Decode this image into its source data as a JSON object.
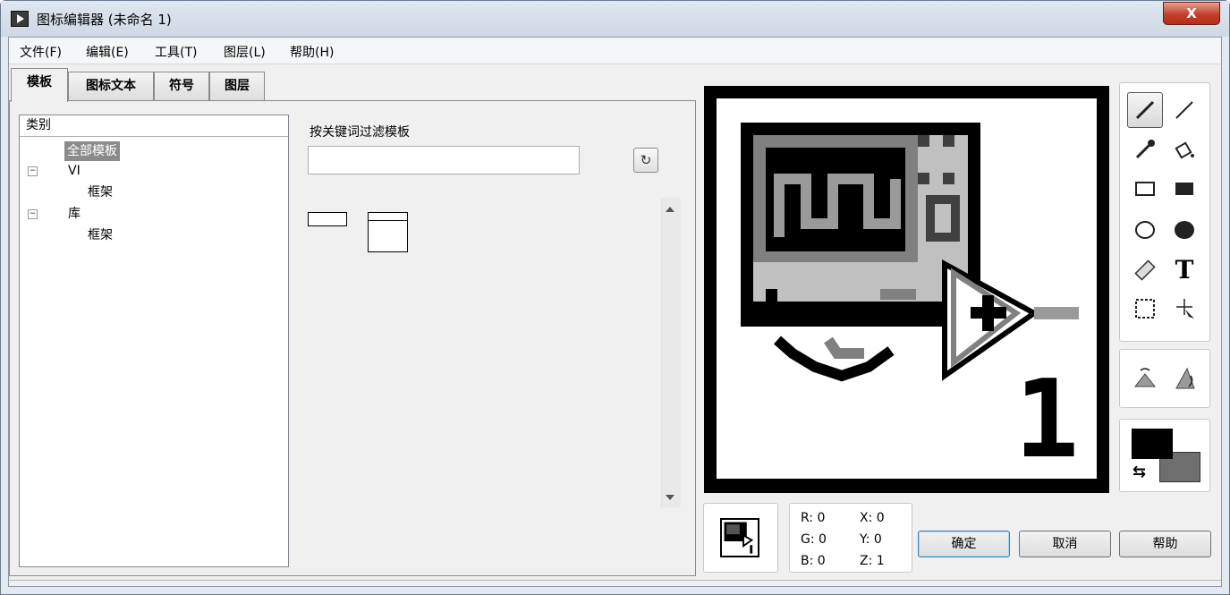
{
  "window": {
    "title": "图标编辑器 (未命名 1)",
    "close_label": "X"
  },
  "menu": [
    "文件(F)",
    "编辑(E)",
    "工具(T)",
    "图层(L)",
    "帮助(H)"
  ],
  "tabs": [
    {
      "label": "模板",
      "active": true
    },
    {
      "label": "图标文本"
    },
    {
      "label": "符号"
    },
    {
      "label": "图层"
    }
  ],
  "category": {
    "header": "类别",
    "items": [
      {
        "label": "全部模板",
        "selected": true
      },
      {
        "label": "VI",
        "expander": "−"
      },
      {
        "label": "框架"
      },
      {
        "label": "库",
        "expander": "−"
      },
      {
        "label": "框架"
      }
    ]
  },
  "filter": {
    "label": "按关键词过滤模板",
    "value": "",
    "refresh_icon": "refresh-icon"
  },
  "coords": {
    "r": "R: 0",
    "g": "G: 0",
    "b": "B: 0",
    "x": "X: 0",
    "y": "Y: 0",
    "z": "Z: 1"
  },
  "buttons": {
    "ok": "确定",
    "cancel": "取消",
    "help": "帮助"
  },
  "colors": {
    "foreground": "#000000",
    "background": "#6e6e6e"
  },
  "canvas_label": "1",
  "tools": [
    "pencil-icon",
    "line-icon",
    "color-picker-icon",
    "fill-icon",
    "rectangle-icon",
    "filled-rectangle-icon",
    "ellipse-icon",
    "filled-ellipse-icon",
    "eraser-icon",
    "text-icon",
    "selection-icon",
    "move-icon",
    "flip-horizontal-icon",
    "rotate-icon"
  ]
}
